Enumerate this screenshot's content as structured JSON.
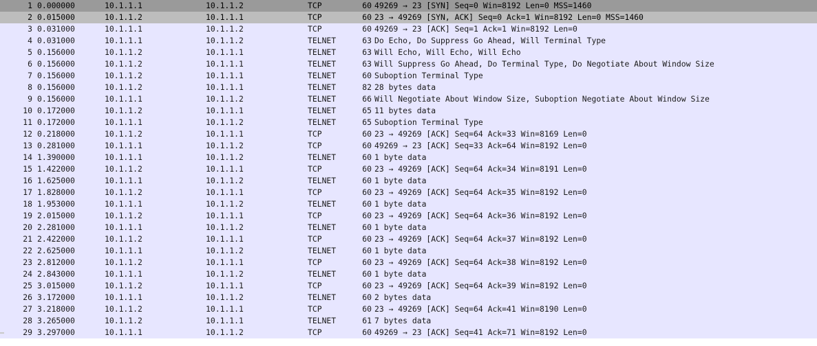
{
  "packets": [
    {
      "no": "1",
      "time": "0.000000",
      "src": "10.1.1.1",
      "dst": "10.1.1.2",
      "proto": "TCP",
      "len": "60",
      "info": "49269 → 23 [SYN] Seq=0 Win=8192 Len=0 MSS=1460",
      "state": "selected"
    },
    {
      "no": "2",
      "time": "0.015000",
      "src": "10.1.1.2",
      "dst": "10.1.1.1",
      "proto": "TCP",
      "len": "60",
      "info": "23 → 49269 [SYN, ACK] Seq=0 Ack=1 Win=8192 Len=0 MSS=1460",
      "state": "related"
    },
    {
      "no": "3",
      "time": "0.031000",
      "src": "10.1.1.1",
      "dst": "10.1.1.2",
      "proto": "TCP",
      "len": "60",
      "info": "49269 → 23 [ACK] Seq=1 Ack=1 Win=8192 Len=0",
      "state": "normal"
    },
    {
      "no": "4",
      "time": "0.031000",
      "src": "10.1.1.1",
      "dst": "10.1.1.2",
      "proto": "TELNET",
      "len": "63",
      "info": "Do Echo, Do Suppress Go Ahead, Will Terminal Type",
      "state": "normal"
    },
    {
      "no": "5",
      "time": "0.156000",
      "src": "10.1.1.2",
      "dst": "10.1.1.1",
      "proto": "TELNET",
      "len": "63",
      "info": "Will Echo, Will Echo, Will Echo",
      "state": "normal"
    },
    {
      "no": "6",
      "time": "0.156000",
      "src": "10.1.1.2",
      "dst": "10.1.1.1",
      "proto": "TELNET",
      "len": "63",
      "info": "Will Suppress Go Ahead, Do Terminal Type, Do Negotiate About Window Size",
      "state": "normal"
    },
    {
      "no": "7",
      "time": "0.156000",
      "src": "10.1.1.2",
      "dst": "10.1.1.1",
      "proto": "TELNET",
      "len": "60",
      "info": "Suboption Terminal Type",
      "state": "normal"
    },
    {
      "no": "8",
      "time": "0.156000",
      "src": "10.1.1.2",
      "dst": "10.1.1.1",
      "proto": "TELNET",
      "len": "82",
      "info": "28 bytes data",
      "state": "normal"
    },
    {
      "no": "9",
      "time": "0.156000",
      "src": "10.1.1.1",
      "dst": "10.1.1.2",
      "proto": "TELNET",
      "len": "66",
      "info": "Will Negotiate About Window Size, Suboption Negotiate About Window Size",
      "state": "normal"
    },
    {
      "no": "10",
      "time": "0.172000",
      "src": "10.1.1.2",
      "dst": "10.1.1.1",
      "proto": "TELNET",
      "len": "65",
      "info": "11 bytes data",
      "state": "normal"
    },
    {
      "no": "11",
      "time": "0.172000",
      "src": "10.1.1.1",
      "dst": "10.1.1.2",
      "proto": "TELNET",
      "len": "65",
      "info": "Suboption Terminal Type",
      "state": "normal"
    },
    {
      "no": "12",
      "time": "0.218000",
      "src": "10.1.1.2",
      "dst": "10.1.1.1",
      "proto": "TCP",
      "len": "60",
      "info": "23 → 49269 [ACK] Seq=64 Ack=33 Win=8169 Len=0",
      "state": "normal"
    },
    {
      "no": "13",
      "time": "0.281000",
      "src": "10.1.1.1",
      "dst": "10.1.1.2",
      "proto": "TCP",
      "len": "60",
      "info": "49269 → 23 [ACK] Seq=33 Ack=64 Win=8192 Len=0",
      "state": "normal"
    },
    {
      "no": "14",
      "time": "1.390000",
      "src": "10.1.1.1",
      "dst": "10.1.1.2",
      "proto": "TELNET",
      "len": "60",
      "info": "1 byte data",
      "state": "normal"
    },
    {
      "no": "15",
      "time": "1.422000",
      "src": "10.1.1.2",
      "dst": "10.1.1.1",
      "proto": "TCP",
      "len": "60",
      "info": "23 → 49269 [ACK] Seq=64 Ack=34 Win=8191 Len=0",
      "state": "normal"
    },
    {
      "no": "16",
      "time": "1.625000",
      "src": "10.1.1.1",
      "dst": "10.1.1.2",
      "proto": "TELNET",
      "len": "60",
      "info": "1 byte data",
      "state": "normal"
    },
    {
      "no": "17",
      "time": "1.828000",
      "src": "10.1.1.2",
      "dst": "10.1.1.1",
      "proto": "TCP",
      "len": "60",
      "info": "23 → 49269 [ACK] Seq=64 Ack=35 Win=8192 Len=0",
      "state": "normal"
    },
    {
      "no": "18",
      "time": "1.953000",
      "src": "10.1.1.1",
      "dst": "10.1.1.2",
      "proto": "TELNET",
      "len": "60",
      "info": "1 byte data",
      "state": "normal"
    },
    {
      "no": "19",
      "time": "2.015000",
      "src": "10.1.1.2",
      "dst": "10.1.1.1",
      "proto": "TCP",
      "len": "60",
      "info": "23 → 49269 [ACK] Seq=64 Ack=36 Win=8192 Len=0",
      "state": "normal"
    },
    {
      "no": "20",
      "time": "2.281000",
      "src": "10.1.1.1",
      "dst": "10.1.1.2",
      "proto": "TELNET",
      "len": "60",
      "info": "1 byte data",
      "state": "normal"
    },
    {
      "no": "21",
      "time": "2.422000",
      "src": "10.1.1.2",
      "dst": "10.1.1.1",
      "proto": "TCP",
      "len": "60",
      "info": "23 → 49269 [ACK] Seq=64 Ack=37 Win=8192 Len=0",
      "state": "normal"
    },
    {
      "no": "22",
      "time": "2.625000",
      "src": "10.1.1.1",
      "dst": "10.1.1.2",
      "proto": "TELNET",
      "len": "60",
      "info": "1 byte data",
      "state": "normal"
    },
    {
      "no": "23",
      "time": "2.812000",
      "src": "10.1.1.2",
      "dst": "10.1.1.1",
      "proto": "TCP",
      "len": "60",
      "info": "23 → 49269 [ACK] Seq=64 Ack=38 Win=8192 Len=0",
      "state": "normal"
    },
    {
      "no": "24",
      "time": "2.843000",
      "src": "10.1.1.1",
      "dst": "10.1.1.2",
      "proto": "TELNET",
      "len": "60",
      "info": "1 byte data",
      "state": "normal"
    },
    {
      "no": "25",
      "time": "3.015000",
      "src": "10.1.1.2",
      "dst": "10.1.1.1",
      "proto": "TCP",
      "len": "60",
      "info": "23 → 49269 [ACK] Seq=64 Ack=39 Win=8192 Len=0",
      "state": "normal"
    },
    {
      "no": "26",
      "time": "3.172000",
      "src": "10.1.1.1",
      "dst": "10.1.1.2",
      "proto": "TELNET",
      "len": "60",
      "info": "2 bytes data",
      "state": "normal"
    },
    {
      "no": "27",
      "time": "3.218000",
      "src": "10.1.1.2",
      "dst": "10.1.1.1",
      "proto": "TCP",
      "len": "60",
      "info": "23 → 49269 [ACK] Seq=64 Ack=41 Win=8190 Len=0",
      "state": "normal"
    },
    {
      "no": "28",
      "time": "3.265000",
      "src": "10.1.1.2",
      "dst": "10.1.1.1",
      "proto": "TELNET",
      "len": "61",
      "info": "7 bytes data",
      "state": "normal"
    },
    {
      "no": "29",
      "time": "3.297000",
      "src": "10.1.1.1",
      "dst": "10.1.1.2",
      "proto": "TCP",
      "len": "60",
      "info": "49269 → 23 [ACK] Seq=41 Ack=71 Win=8192 Len=0",
      "state": "normal"
    }
  ],
  "colors": {
    "row_background": "#e7e6ff",
    "selected_background": "#9a9a9a",
    "related_background": "#bdbdbd",
    "text": "#1a1a1a"
  }
}
